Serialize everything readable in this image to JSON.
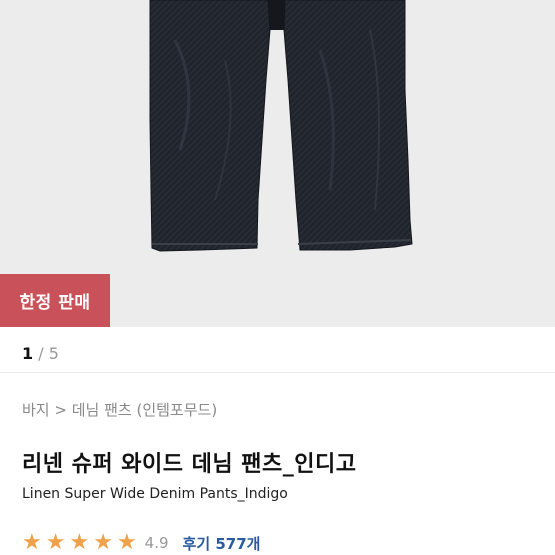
{
  "badge": {
    "label": "한정 판매"
  },
  "pager": {
    "current": "1",
    "separator": " / ",
    "total": "5"
  },
  "breadcrumb": {
    "category": "바지",
    "arrow": " > ",
    "subcategory": "데님 팬츠",
    "brand": "(인템포무드)"
  },
  "product": {
    "title_ko": "리넨 슈퍼 와이드 데님 팬츠_인디고",
    "title_en": "Linen Super Wide Denim Pants_Indigo"
  },
  "rating": {
    "stars": 5,
    "value": "4.9",
    "reviews_label": "후기 577개"
  },
  "colors": {
    "badge_bg": "#c9525a",
    "star": "#f0a24a",
    "link": "#2a5b9e",
    "image_bg": "#ececec",
    "denim": "#1f2229"
  }
}
